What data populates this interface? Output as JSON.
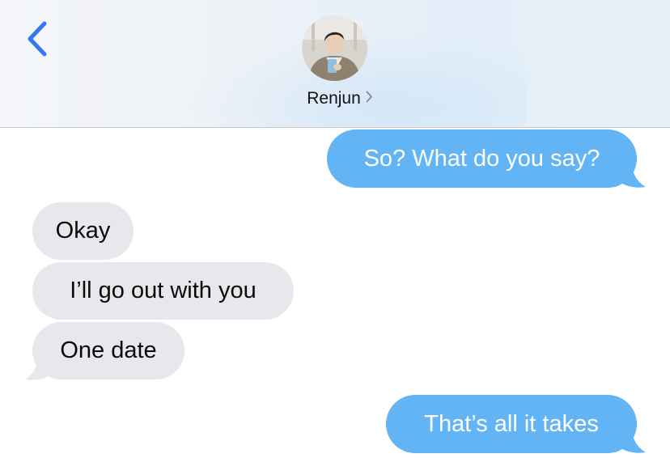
{
  "header": {
    "back_icon": "chevron-left-icon",
    "avatar_icon": "contact-photo",
    "contact_name": "Renjun",
    "contact_chevron_icon": "chevron-right-icon"
  },
  "messages": [
    {
      "direction": "sent",
      "text": "So? What do you say?"
    },
    {
      "direction": "received",
      "text": "Okay"
    },
    {
      "direction": "received",
      "text": "I’ll go out with you"
    },
    {
      "direction": "received",
      "text": "One date"
    },
    {
      "direction": "sent",
      "text": "That’s all it takes"
    }
  ],
  "colors": {
    "sent_bubble": "#62b4f4",
    "received_bubble": "#e8e8ec",
    "accent": "#3478f6"
  }
}
